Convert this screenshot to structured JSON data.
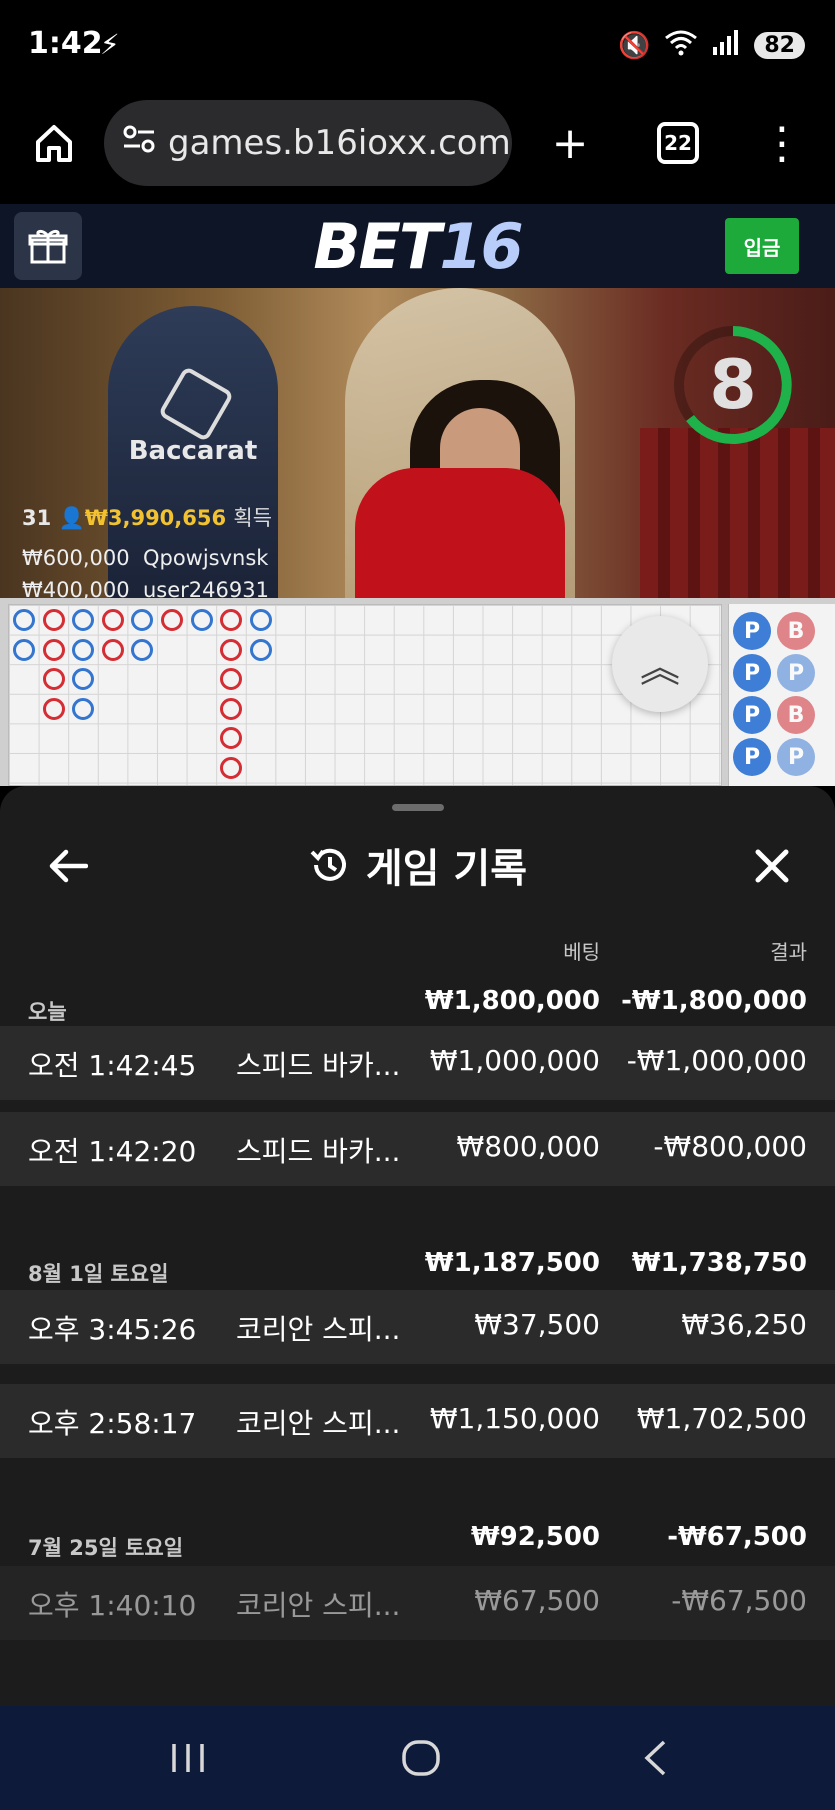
{
  "status_bar": {
    "time": "1:42",
    "battery": "82"
  },
  "browser": {
    "url": "games.b16ioxx.com/",
    "tab_count": "22"
  },
  "site": {
    "logo_main": "BET",
    "logo_num": "16",
    "deposit_label": "입금"
  },
  "video": {
    "table_name": "Baccarat",
    "timer": "8",
    "player_count": "31",
    "win_amount": "₩3,990,656",
    "win_label": "획득",
    "winners": [
      {
        "amount": "₩600,000",
        "user": "Qpowjsvnsk"
      },
      {
        "amount": "₩400,000",
        "user": "user246931"
      }
    ]
  },
  "bead_road": [
    "P",
    "P",
    "P",
    "P",
    "B",
    "P",
    "B",
    "P"
  ],
  "panel": {
    "title": "게임 기록",
    "col_bet": "베팅",
    "col_result": "결과",
    "groups": [
      {
        "label": "오늘",
        "bet": "₩1,800,000",
        "result": "-₩1,800,000",
        "rows": [
          {
            "time": "오전 1:42:45",
            "game": "스피드 바카...",
            "bet": "₩1,000,000",
            "result": "-₩1,000,000"
          },
          {
            "time": "오전 1:42:20",
            "game": "스피드 바카...",
            "bet": "₩800,000",
            "result": "-₩800,000"
          }
        ]
      },
      {
        "label": "8월 1일 토요일",
        "bet": "₩1,187,500",
        "result": "₩1,738,750",
        "rows": [
          {
            "time": "오후 3:45:26",
            "game": "코리안 스피...",
            "bet": "₩37,500",
            "result": "₩36,250"
          },
          {
            "time": "오후 2:58:17",
            "game": "코리안 스피...",
            "bet": "₩1,150,000",
            "result": "₩1,702,500"
          }
        ]
      },
      {
        "label": "7월 25일 토요일",
        "bet": "₩92,500",
        "result": "-₩67,500",
        "rows": [
          {
            "time": "오후 1:40:10",
            "game": "코리안 스피...",
            "bet": "₩67,500",
            "result": "-₩67,500"
          }
        ]
      }
    ]
  },
  "colors": {
    "deposit_green": "#1eaa3a",
    "banker_red": "#d42d34",
    "player_blue": "#3375cf",
    "win_gold": "#f2c230"
  }
}
